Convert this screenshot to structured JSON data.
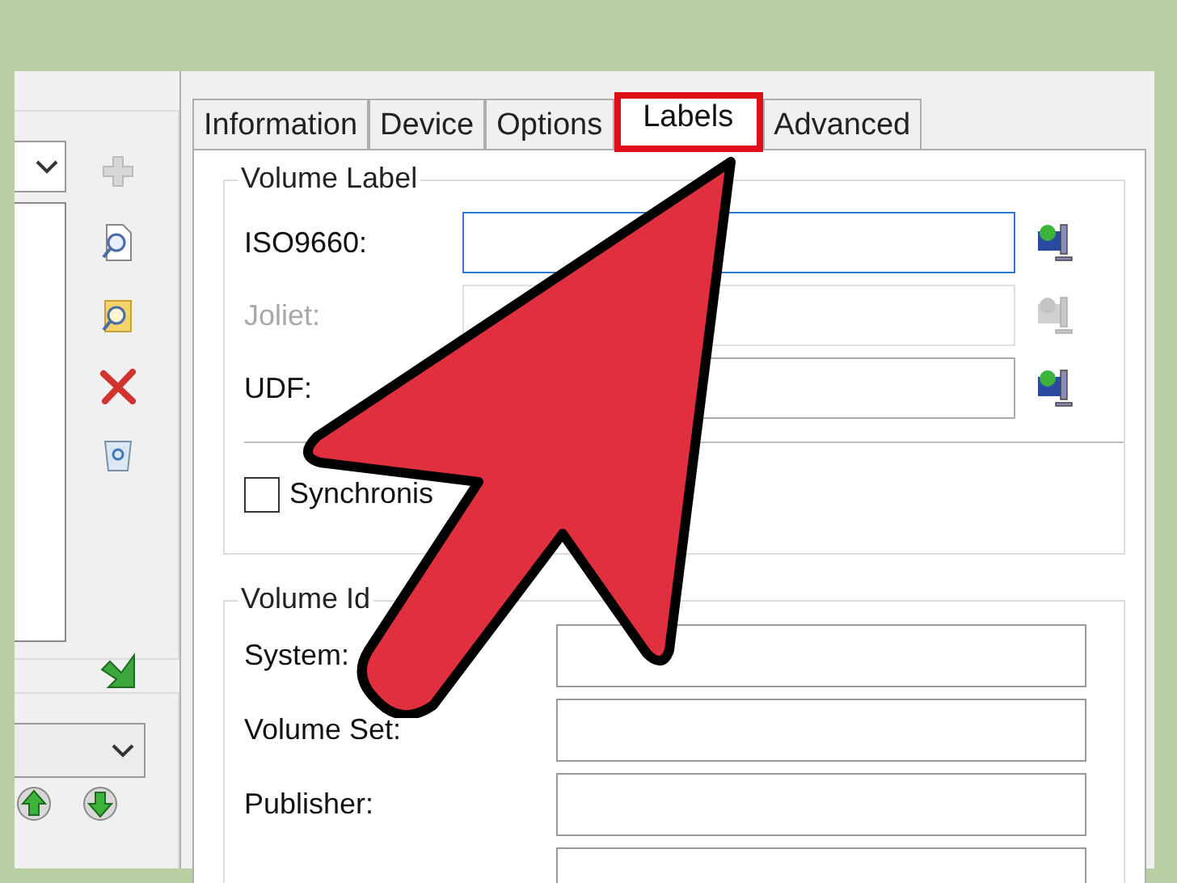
{
  "left_panel": {
    "toolbar": [
      {
        "kind": "add",
        "disabled": true
      },
      {
        "kind": "find-file",
        "disabled": false
      },
      {
        "kind": "find-folder",
        "disabled": false
      },
      {
        "kind": "remove",
        "disabled": false
      },
      {
        "kind": "clear",
        "disabled": false
      },
      {
        "kind": "import",
        "disabled": false
      }
    ],
    "order_buttons": [
      {
        "kind": "up"
      },
      {
        "kind": "down"
      }
    ]
  },
  "tabs": [
    {
      "label": "Information",
      "selected": false
    },
    {
      "label": "Device",
      "selected": false
    },
    {
      "label": "Options",
      "selected": false
    },
    {
      "label": "Labels",
      "selected": true
    },
    {
      "label": "Advanced",
      "selected": false
    }
  ],
  "volume_label": {
    "title": "Volume Label",
    "fields": [
      {
        "label": "ISO9660:",
        "disabled": false,
        "focused": true
      },
      {
        "label": "Joliet:",
        "disabled": true,
        "focused": false
      },
      {
        "label": "UDF:",
        "disabled": false,
        "focused": false
      }
    ],
    "checkbox": {
      "label": "Synchronis",
      "checked": false
    }
  },
  "volume_identifier": {
    "title": "Volume Id",
    "fields": [
      {
        "kind": "labeled",
        "label": "System:"
      },
      {
        "kind": "labeled",
        "label": "Volume Set:"
      },
      {
        "kind": "labeled",
        "label": "Publisher:"
      },
      {
        "kind": "unlabeled"
      }
    ]
  }
}
